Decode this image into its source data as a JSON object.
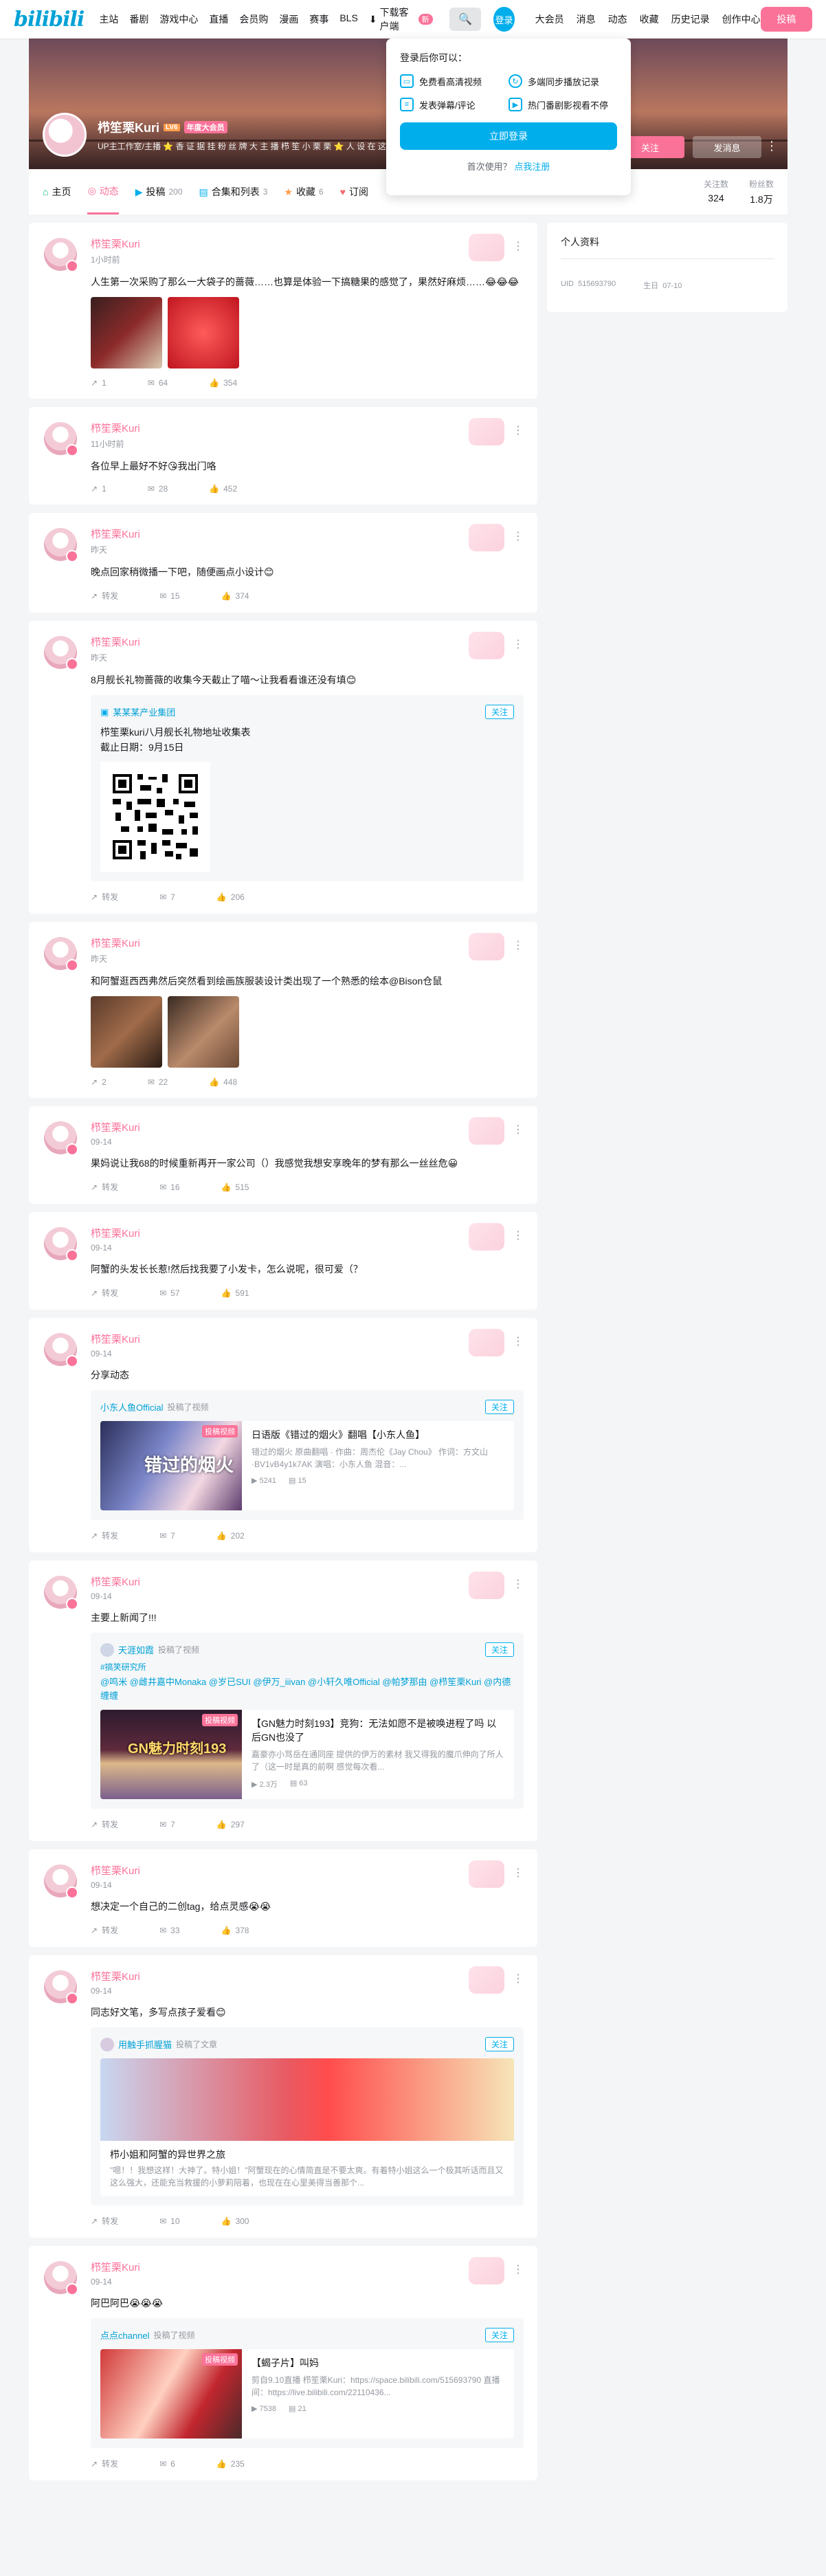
{
  "nav": {
    "logo": "bilibili",
    "left": [
      "主站",
      "番剧",
      "游戏中心",
      "直播",
      "会员购",
      "漫画",
      "赛事",
      "BLS"
    ],
    "download": "下载客户端",
    "download_badge": "新",
    "search_icon": "search-icon",
    "login": "登录",
    "right": [
      "大会员",
      "消息",
      "动态",
      "收藏",
      "历史记录",
      "创作中心"
    ],
    "post": "投稿"
  },
  "profile": {
    "name": "栉笙栗Kuri",
    "level": "LV6",
    "vip": "年度大会员",
    "sign": "UP主工作室/主播 ⭐ 香 证 据 挂 粉 丝 牌 大 主 播 栉 笙 小 栗 栗 ⭐ 人 设 在 这 里 看",
    "follow": "关注",
    "message": "发消息",
    "more": "⋮"
  },
  "tabs": [
    {
      "label": "主页",
      "count": "",
      "icon": "home-icon"
    },
    {
      "label": "动态",
      "count": "",
      "icon": "dynamic-icon"
    },
    {
      "label": "投稿",
      "count": "200",
      "icon": "video-icon"
    },
    {
      "label": "合集和列表",
      "count": "3",
      "icon": "collection-icon"
    },
    {
      "label": "收藏",
      "count": "6",
      "icon": "star-icon"
    },
    {
      "label": "订阅",
      "count": "",
      "icon": "heart-icon"
    }
  ],
  "stats": [
    {
      "label": "关注数",
      "value": "324"
    },
    {
      "label": "粉丝数",
      "value": "1.8万"
    }
  ],
  "popover": {
    "header": "登录后你可以：",
    "perks": [
      "免费看高清视频",
      "多端同步播放记录",
      "发表弹幕/评论",
      "热门番剧影视看不停"
    ],
    "login_now": "立即登录",
    "first_use": "首次使用？",
    "register": "点我注册"
  },
  "sidebar": {
    "title": "个人资料",
    "uid_label": "UID",
    "uid": "515693790",
    "birthday_label": "生日",
    "birthday": "07-10"
  },
  "feed": [
    {
      "name": "栉笙栗Kuri",
      "time": "1小时前",
      "text": "人生第一次采购了那么一大袋子的蔷薇……也算是体验一下搞糖果的感觉了，果然好麻烦……😂😂😂",
      "pics": 2,
      "share": "1",
      "comment": "64",
      "like": "354"
    },
    {
      "name": "栉笙栗Kuri",
      "time": "11小时前",
      "text": "各位早上最好不好😘我出门咯",
      "share": "1",
      "comment": "28",
      "like": "452"
    },
    {
      "name": "栉笙栗Kuri",
      "time": "昨天",
      "text": "晚点回家稍微播一下吧，随便画点小设计😊",
      "share": "转发",
      "comment": "15",
      "like": "374"
    },
    {
      "name": "栉笙栗Kuri",
      "time": "昨天",
      "text": "8月舰长礼物蔷薇的收集今天截止了喵～让我看看谁还没有填😊",
      "sub": {
        "author": "某某某产业集团",
        "follow": "关注",
        "text": "栉笙栗kuri八月舰长礼物地址收集表\n截止日期：9月15日"
      },
      "share": "转发",
      "comment": "7",
      "like": "206"
    },
    {
      "name": "栉笙栗Kuri",
      "time": "昨天",
      "text": "和阿蟹逛西西弗然后突然看到绘画族服装设计类出现了一个熟悉的绘本@Bison仓鼠",
      "pics": 2,
      "share": "2",
      "comment": "22",
      "like": "448"
    },
    {
      "name": "栉笙栗Kuri",
      "time": "09-14",
      "text": "果妈说让我68的时候重新再开一家公司（）我感觉我想安享晚年的梦有那么一丝丝危😀",
      "share": "转发",
      "comment": "16",
      "like": "515"
    },
    {
      "name": "栉笙栗Kuri",
      "time": "09-14",
      "text": "阿蟹的头发长长惹!然后找我要了小发卡，怎么说呢，很可爱（？",
      "share": "转发",
      "comment": "57",
      "like": "591"
    },
    {
      "name": "栉笙栗Kuri",
      "time": "09-14",
      "text": "分享动态",
      "video": {
        "author": "小东人鱼Official",
        "action": "投稿了视频",
        "follow": "关注",
        "tag": "投稿视频",
        "thumb_text": "错过的烟火",
        "title": "日语版《错过的烟火》翻唱【小东人鱼】",
        "desc": "错过的烟火 原曲翻唱 · 作曲：周杰伦《Jay Chou》 作词：方文山·BV1vB4y1k7AK 演唱：小东人鱼 混音：...",
        "plays": "5241",
        "danmaku": "15"
      },
      "share": "转发",
      "comment": "7",
      "like": "202"
    },
    {
      "name": "栉笙栗Kuri",
      "time": "09-14",
      "text": "主要上新闻了!!!",
      "video": {
        "author": "天涯如霞",
        "action": "投稿了视频",
        "follow": "关注",
        "tag": "投稿视频",
        "topic": "#搞笑研究所",
        "mentions": "@鸣米 @雌井嘉中Monaka @岁已SUI @伊万_iiivan @小轩久唯Official @帕梦那由 @栉笙栗Kuri @内德缠缠",
        "thumb_text": "GN魅力时刻193",
        "title": "【GN魅力时刻193】竞狗：无法如愿不是被唤进程了吗 以后GN也没了",
        "desc": "嘉豪亦小骂岳在通同座 提供的伊万的素材 我又得我的魔爪伸向了所人了（这一时是真的前啊 感觉每次看...",
        "plays": "2.3万",
        "danmaku": "63"
      },
      "share": "转发",
      "comment": "7",
      "like": "297"
    },
    {
      "name": "栉笙栗Kuri",
      "time": "09-14",
      "text": "想决定一个自己的二创tag，给点灵感😭😭",
      "share": "转发",
      "comment": "33",
      "like": "378"
    },
    {
      "name": "栉笙栗Kuri",
      "time": "09-14",
      "text": "同志好文笔，多写点孩子爱看😊",
      "article": {
        "author": "用触手抓腥猫",
        "action": "投稿了文章",
        "follow": "关注",
        "title": "栉小姐和阿蟹的异世界之旅",
        "desc": "\"嗯！！我想这样！大神了。特小姐！\"阿蟹现在的心情简直是不要太爽。有着特小姐这么一个极其听话而且又这么强大，还能充当救援的小萝莉陪着，也现在在心里美得当善那个..."
      },
      "share": "转发",
      "comment": "10",
      "like": "300"
    },
    {
      "name": "栉笙栗Kuri",
      "time": "09-14",
      "text": "阿巴阿巴😭😭😭",
      "video": {
        "author": "点点channel",
        "action": "投稿了视频",
        "follow": "关注",
        "tag": "投稿视频",
        "thumb_text": "",
        "title": "【蝎子片】叫妈",
        "desc": "剪自9.10直播 栉笙栗Kuri：https://space.bilibili.com/515693790 直播间：https://live.bilibili.com/22110436...",
        "plays": "7538",
        "danmaku": "21"
      },
      "share": "转发",
      "comment": "6",
      "like": "235"
    }
  ],
  "colors": {
    "accent": "#fb7299",
    "blue": "#00aeec",
    "bg": "#f4f5f7"
  }
}
